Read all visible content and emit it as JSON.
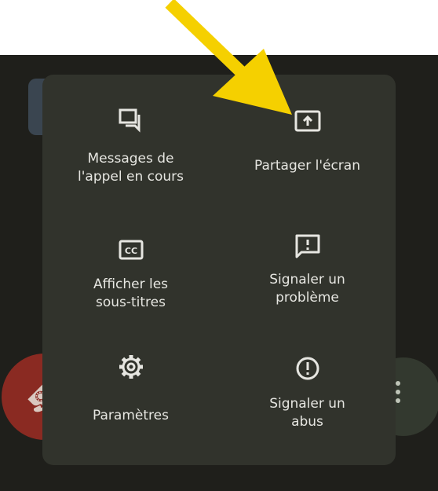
{
  "menu": {
    "items": [
      {
        "label": "Messages de\nl'appel en cours",
        "icon": "chat-messages-icon"
      },
      {
        "label": "Partager l'écran",
        "icon": "present-screen-icon"
      },
      {
        "label": "Afficher les\nsous-titres",
        "icon": "closed-captions-icon"
      },
      {
        "label": "Signaler un\nproblème",
        "icon": "feedback-icon"
      },
      {
        "label": "Paramètres",
        "icon": "settings-gear-icon"
      },
      {
        "label": "Signaler un\nabus",
        "icon": "report-abuse-icon"
      }
    ]
  },
  "colors": {
    "panel_bg": "#31332c",
    "text": "#e6e6e1",
    "arrow": "#f5d000",
    "end_call": "#8a2a22"
  }
}
